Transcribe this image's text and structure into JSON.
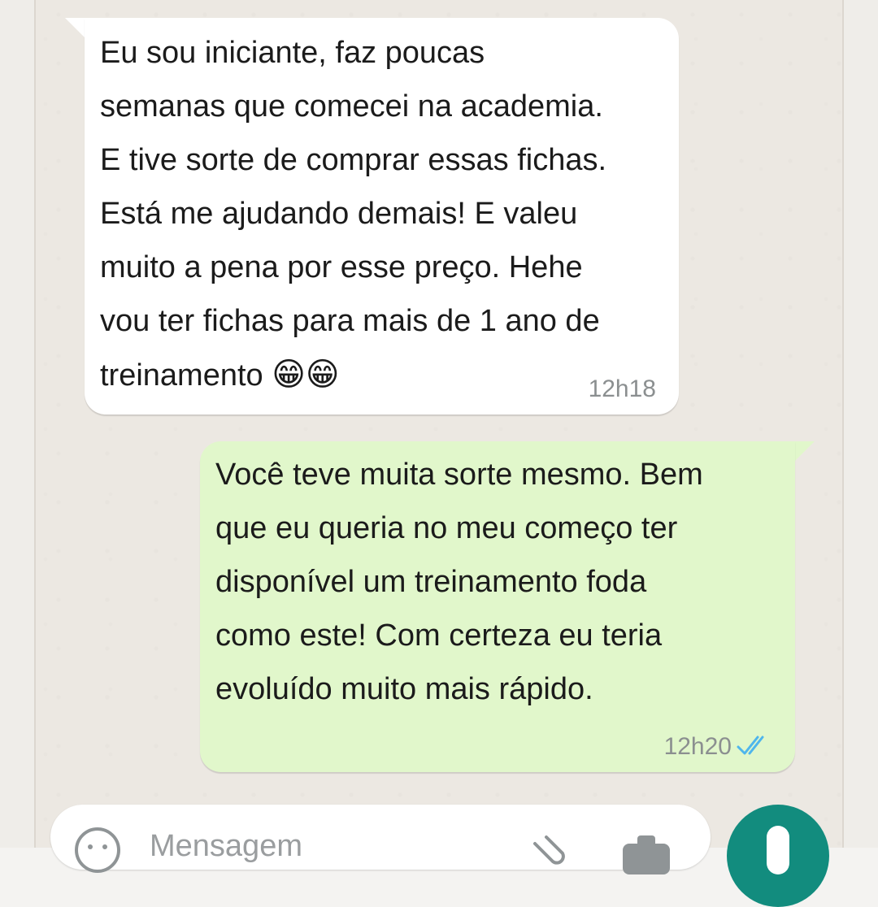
{
  "messages": [
    {
      "direction": "incoming",
      "text": " Eu sou iniciante, faz poucas\nsemanas que comecei na academia.\nE tive sorte de comprar essas fichas.\nEstá me ajudando demais! E valeu\nmuito a pena por esse preço. Hehe\nvou ter fichas para mais de 1 ano de\ntreinamento ",
      "emoji": "😁😁",
      "time": "12h18"
    },
    {
      "direction": "outgoing",
      "text": " Você teve muita sorte mesmo. Bem\nque eu queria no meu começo ter\ndisponível um treinamento foda\ncomo este! Com certeza eu teria\nevoluído muito mais rápido.",
      "time": "12h20",
      "status_icon": "double-check-read-icon"
    }
  ],
  "composer": {
    "placeholder": "Mensagem",
    "icons": [
      "emoji-icon",
      "attach-clip-icon",
      "camera-icon",
      "mic-icon"
    ]
  },
  "colors": {
    "incoming_bubble": "#ffffff",
    "outgoing_bubble": "#e1f7cb",
    "read_ticks": "#4fb6ec",
    "mic_button": "#128c7e",
    "chat_background": "#ece8e2"
  }
}
